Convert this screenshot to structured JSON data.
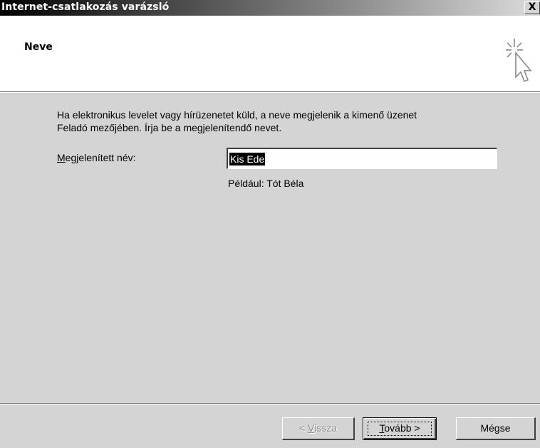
{
  "window": {
    "title": "Internet-csatlakozás varázsló",
    "close_glyph": "X"
  },
  "header": {
    "title": "Neve",
    "icon": "wizard-cursor-sparkle-icon"
  },
  "main": {
    "description_line1": "Ha elektronikus levelet vagy hírüzenetet küld, a neve megjelenik a kimenő üzenet",
    "description_line2": "Feladó mezőjében. Írja be a megjelenítendő nevet.",
    "display_name_label_access": "M",
    "display_name_label_rest": "egjelenített név:",
    "display_name_value": "Kis Ede",
    "example_text": "Például: Tót Béla"
  },
  "buttons": {
    "back_prefix": "< ",
    "back_access": "V",
    "back_rest": "issza",
    "next_access": "T",
    "next_rest": "ovább >",
    "cancel_label": "Mégse"
  }
}
